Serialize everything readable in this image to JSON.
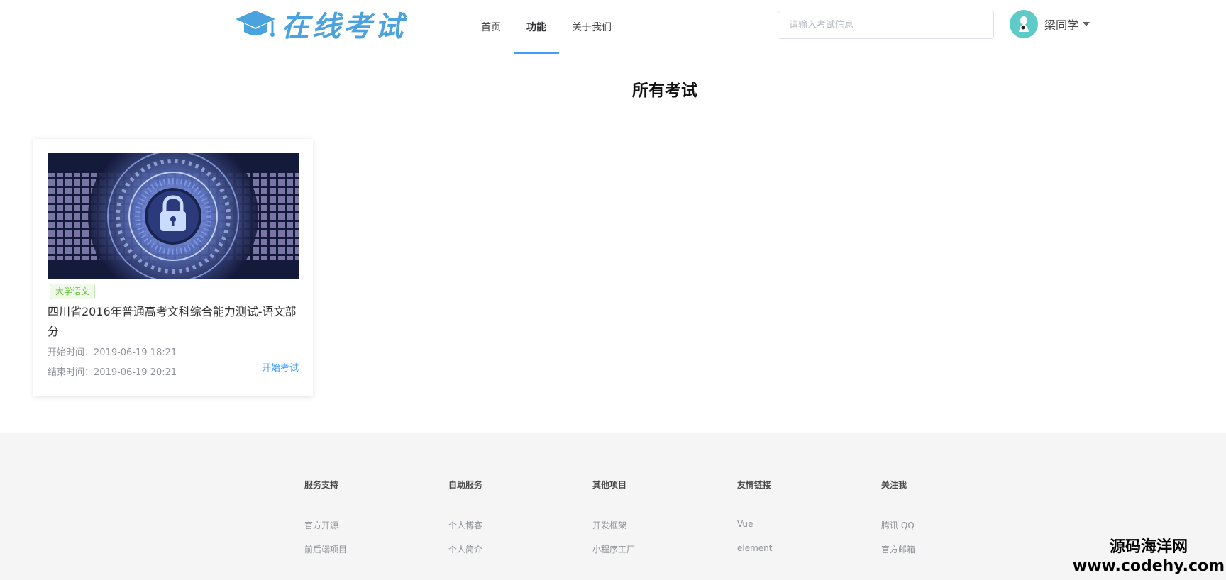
{
  "header": {
    "logo_text": "在线考试",
    "nav": [
      {
        "label": "首页"
      },
      {
        "label": "功能"
      },
      {
        "label": "关于我们"
      }
    ],
    "search": {
      "placeholder": "请输入考试信息",
      "value": ""
    },
    "user": {
      "name": "梁同学"
    }
  },
  "main": {
    "page_title": "所有考试",
    "exams": [
      {
        "tag": "大学语文",
        "title": "四川省2016年普通高考文科综合能力测试-语文部分",
        "start_time": "开始时间：2019-06-19 18:21",
        "end_time": "结束时间：2019-06-19 20:21",
        "action_label": "开始考试"
      }
    ]
  },
  "footer": {
    "columns": [
      {
        "title": "服务支持",
        "links": [
          "官方开源",
          "前后端项目"
        ]
      },
      {
        "title": "自助服务",
        "links": [
          "个人博客",
          "个人简介"
        ]
      },
      {
        "title": "其他项目",
        "links": [
          "开发框架",
          "小程序工厂"
        ]
      },
      {
        "title": "友情链接",
        "links": [
          "Vue",
          "element"
        ]
      },
      {
        "title": "关注我",
        "links": [
          "腾讯 QQ",
          "官方邮箱"
        ]
      }
    ]
  },
  "watermark": {
    "line1": "源码海洋网",
    "line2": "www.codehy.com"
  },
  "colors": {
    "accent": "#409eff",
    "logo": "#4aa3df",
    "tag_green": "#67c23a",
    "avatar_bg": "#5fcbc9"
  }
}
